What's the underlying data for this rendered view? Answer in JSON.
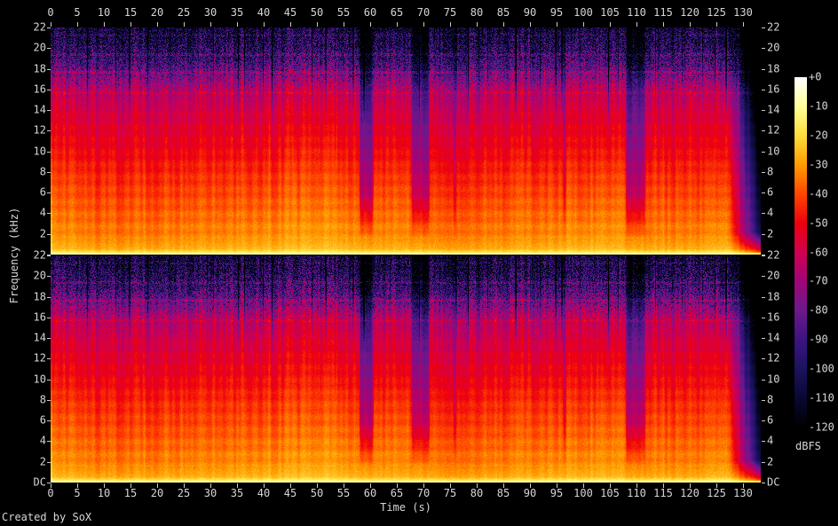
{
  "colors": {
    "background": "#000000",
    "label_text": "#d6d6d6",
    "tick": "#c8c8c8"
  },
  "watermark": {
    "text": "Created by SoX"
  },
  "chart_data": {
    "type": "heatmap",
    "subtype": "audio-spectrogram",
    "title": "",
    "xlabel": "Time (s)",
    "ylabel": "Frequency (kHz)",
    "channels": 2,
    "x_range_s": [
      0,
      133.3
    ],
    "y_range_khz": [
      0,
      22
    ],
    "x_tick_values": [
      0,
      5,
      10,
      15,
      20,
      25,
      30,
      35,
      40,
      45,
      50,
      55,
      60,
      65,
      70,
      75,
      80,
      85,
      90,
      95,
      100,
      105,
      110,
      115,
      120,
      125,
      130
    ],
    "y_tick_values_khz": [
      22,
      20,
      18,
      16,
      14,
      12,
      10,
      8,
      6,
      4,
      2
    ],
    "dc_label": "DC",
    "grid": false,
    "colorbar": {
      "label": "dBFS",
      "db_range": [
        0,
        -120
      ],
      "tick_labels": [
        "+0",
        "-10",
        "-20",
        "-30",
        "-40",
        "-50",
        "-60",
        "-70",
        "-80",
        "-90",
        "-100",
        "-110",
        "-120"
      ]
    },
    "palette_stops_db_rgb": [
      [
        0,
        255,
        255,
        255
      ],
      [
        -10,
        255,
        255,
        150
      ],
      [
        -20,
        255,
        220,
        60
      ],
      [
        -30,
        255,
        155,
        0
      ],
      [
        -40,
        255,
        70,
        0
      ],
      [
        -50,
        238,
        0,
        15
      ],
      [
        -60,
        209,
        0,
        80
      ],
      [
        -70,
        160,
        5,
        120
      ],
      [
        -80,
        108,
        25,
        140
      ],
      [
        -90,
        60,
        20,
        130
      ],
      [
        -100,
        28,
        18,
        95
      ],
      [
        -110,
        10,
        8,
        50
      ],
      [
        -120,
        0,
        0,
        0
      ]
    ],
    "spectrum_model": {
      "base_points_khz_db": [
        [
          0,
          -10
        ],
        [
          0.15,
          -14
        ],
        [
          0.5,
          -25
        ],
        [
          1.5,
          -30
        ],
        [
          3,
          -33
        ],
        [
          5,
          -37
        ],
        [
          8,
          -43
        ],
        [
          10,
          -48
        ],
        [
          12,
          -52
        ],
        [
          14,
          -57
        ],
        [
          16,
          -63
        ],
        [
          17,
          -71
        ],
        [
          18,
          -80
        ],
        [
          19,
          -88
        ],
        [
          20,
          -93
        ],
        [
          21,
          -98
        ],
        [
          22,
          -101
        ]
      ],
      "dc_line_db": -7,
      "tonal_lines_khz_db": [
        [
          15.7,
          5
        ],
        [
          17.7,
          8
        ],
        [
          19.4,
          8
        ],
        [
          21.3,
          6
        ]
      ],
      "dips_s_s_db": [
        [
          57.8,
          60.6,
          24
        ],
        [
          67.6,
          71.2,
          22
        ],
        [
          75.4,
          76.2,
          12
        ],
        [
          96.0,
          96.8,
          10
        ],
        [
          107.8,
          111.6,
          22
        ]
      ],
      "fade_start_s": 126.8,
      "fade_db_per_s": 12,
      "seed": 20240613
    }
  }
}
